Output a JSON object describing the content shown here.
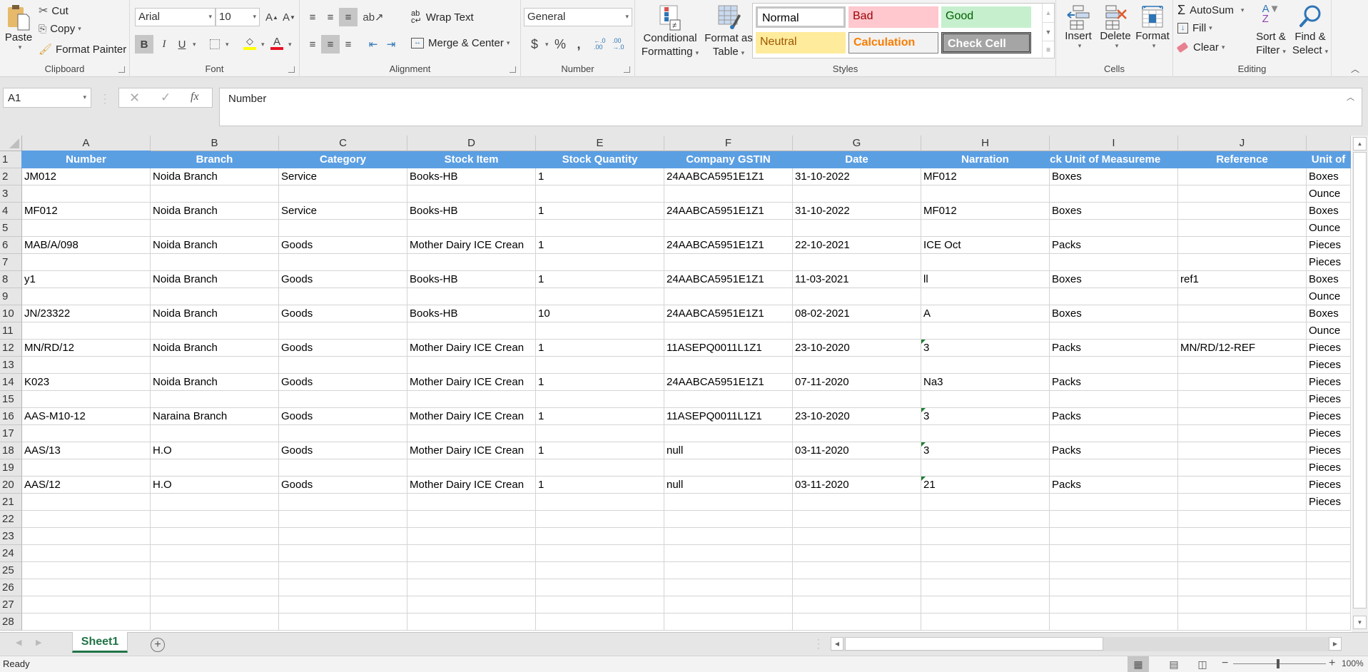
{
  "ribbon": {
    "clipboard": {
      "paste": "Paste",
      "cut": "Cut",
      "copy": "Copy",
      "format_painter": "Format Painter",
      "label": "Clipboard"
    },
    "font": {
      "name": "Arial",
      "size": "10",
      "bold": "B",
      "italic": "I",
      "underline": "U",
      "label": "Font",
      "fill_color": "#ffff00",
      "font_color": "#e81123"
    },
    "alignment": {
      "wrap_text": "Wrap Text",
      "merge_center": "Merge & Center",
      "label": "Alignment"
    },
    "number": {
      "format": "General",
      "currency": "$",
      "percent": "%",
      "comma": ",",
      "inc_decimal": "←.0 .00",
      "dec_decimal": ".00 →.0",
      "label": "Number"
    },
    "styles": {
      "conditional_formatting": [
        "Conditional",
        "Formatting"
      ],
      "format_as_table": [
        "Format as",
        "Table"
      ],
      "label": "Styles",
      "gallery": [
        {
          "name": "Normal",
          "bg": "#ffffff",
          "fg": "#000000"
        },
        {
          "name": "Bad",
          "bg": "#ffc7ce",
          "fg": "#9c0006"
        },
        {
          "name": "Good",
          "bg": "#c6efce",
          "fg": "#006100"
        },
        {
          "name": "Neutral",
          "bg": "#ffeb9c",
          "fg": "#9c5700"
        },
        {
          "name": "Calculation",
          "bg": "#f2f2f2",
          "fg": "#fa7d00"
        },
        {
          "name": "Check Cell",
          "bg": "#a5a5a5",
          "fg": "#ffffff"
        }
      ]
    },
    "cells": {
      "insert": "Insert",
      "delete": "Delete",
      "format": "Format",
      "label": "Cells"
    },
    "editing": {
      "autosum": "AutoSum",
      "fill": "Fill",
      "clear": "Clear",
      "sort_filter": [
        "Sort &",
        "Filter"
      ],
      "find_select": [
        "Find &",
        "Select"
      ],
      "label": "Editing"
    }
  },
  "formula_bar": {
    "name_box": "A1",
    "fx": "fx",
    "content": "Number"
  },
  "sheet": {
    "columns": [
      "A",
      "B",
      "C",
      "D",
      "E",
      "F",
      "G",
      "H",
      "I",
      "J",
      ""
    ],
    "rows": [
      "1",
      "2",
      "3",
      "4",
      "5",
      "6",
      "7",
      "8",
      "9",
      "10",
      "11",
      "12",
      "13",
      "14",
      "15",
      "16",
      "17",
      "18",
      "19",
      "20",
      "21",
      "22",
      "23",
      "24",
      "25",
      "26",
      "27",
      "28"
    ],
    "header": [
      "Number",
      "Branch",
      "Category",
      "Stock Item",
      "Stock Quantity",
      "Company GSTIN",
      "Date",
      "Narration",
      "tock Unit of Measureme",
      "Reference",
      "Unit of"
    ],
    "data": [
      [
        "JM012",
        "Noida Branch",
        "Service",
        "Books-HB",
        "1",
        "24AABCA5951E1Z1",
        "31-10-2022",
        "MF012",
        "Boxes",
        "",
        "Boxes"
      ],
      [
        "",
        "",
        "",
        "",
        "",
        "",
        "",
        "",
        "",
        "",
        "Ounce"
      ],
      [
        "MF012",
        "Noida Branch",
        "Service",
        "Books-HB",
        "1",
        "24AABCA5951E1Z1",
        "31-10-2022",
        "MF012",
        "Boxes",
        "",
        "Boxes"
      ],
      [
        "",
        "",
        "",
        "",
        "",
        "",
        "",
        "",
        "",
        "",
        "Ounce"
      ],
      [
        "MAB/A/098",
        "Noida Branch",
        "Goods",
        "Mother Dairy ICE Crean",
        "1",
        "24AABCA5951E1Z1",
        "22-10-2021",
        "ICE Oct",
        "Packs",
        "",
        "Pieces"
      ],
      [
        "",
        "",
        "",
        "",
        "",
        "",
        "",
        "",
        "",
        "",
        "Pieces"
      ],
      [
        "y1",
        "Noida Branch",
        "Goods",
        "Books-HB",
        "1",
        "24AABCA5951E1Z1",
        "11-03-2021",
        "ll",
        "Boxes",
        "ref1",
        "Boxes"
      ],
      [
        "",
        "",
        "",
        "",
        "",
        "",
        "",
        "",
        "",
        "",
        "Ounce"
      ],
      [
        "JN/23322",
        "Noida Branch",
        "Goods",
        "Books-HB",
        "10",
        "24AABCA5951E1Z1",
        "08-02-2021",
        "A",
        "Boxes",
        "",
        "Boxes"
      ],
      [
        "",
        "",
        "",
        "",
        "",
        "",
        "",
        "",
        "",
        "",
        "Ounce"
      ],
      [
        "MN/RD/12",
        "Noida Branch",
        "Goods",
        "Mother Dairy ICE Crean",
        "1",
        "11ASEPQ0011L1Z1",
        "23-10-2020",
        "3",
        "Packs",
        "MN/RD/12-REF",
        "Pieces"
      ],
      [
        "",
        "",
        "",
        "",
        "",
        "",
        "",
        "",
        "",
        "",
        "Pieces"
      ],
      [
        "K023",
        "Noida Branch",
        "Goods",
        "Mother Dairy ICE Crean",
        "1",
        "24AABCA5951E1Z1",
        "07-11-2020",
        "Na3",
        "Packs",
        "",
        "Pieces"
      ],
      [
        "",
        "",
        "",
        "",
        "",
        "",
        "",
        "",
        "",
        "",
        "Pieces"
      ],
      [
        "AAS-M10-12",
        "Naraina Branch",
        "Goods",
        "Mother Dairy ICE Crean",
        "1",
        "11ASEPQ0011L1Z1",
        "23-10-2020",
        "3",
        "Packs",
        "",
        "Pieces"
      ],
      [
        "",
        "",
        "",
        "",
        "",
        "",
        "",
        "",
        "",
        "",
        "Pieces"
      ],
      [
        "AAS/13",
        "H.O",
        "Goods",
        "Mother Dairy ICE Crean",
        "1",
        "null",
        "03-11-2020",
        "3",
        "Packs",
        "",
        "Pieces"
      ],
      [
        "",
        "",
        "",
        "",
        "",
        "",
        "",
        "",
        "",
        "",
        "Pieces"
      ],
      [
        "AAS/12",
        "H.O",
        "Goods",
        "Mother Dairy ICE Crean",
        "1",
        "null",
        "03-11-2020",
        "21",
        "Packs",
        "",
        "Pieces"
      ],
      [
        "",
        "",
        "",
        "",
        "",
        "",
        "",
        "",
        "",
        "",
        "Pieces"
      ]
    ],
    "error_flags": [
      [
        12,
        7
      ],
      [
        16,
        7
      ],
      [
        18,
        7
      ],
      [
        20,
        7
      ]
    ],
    "header_color": "#5b9fe3"
  },
  "tabs": {
    "sheets": [
      "Sheet1"
    ],
    "active": "Sheet1",
    "add": "+"
  },
  "status": {
    "text": "Ready",
    "zoom": "100%"
  }
}
